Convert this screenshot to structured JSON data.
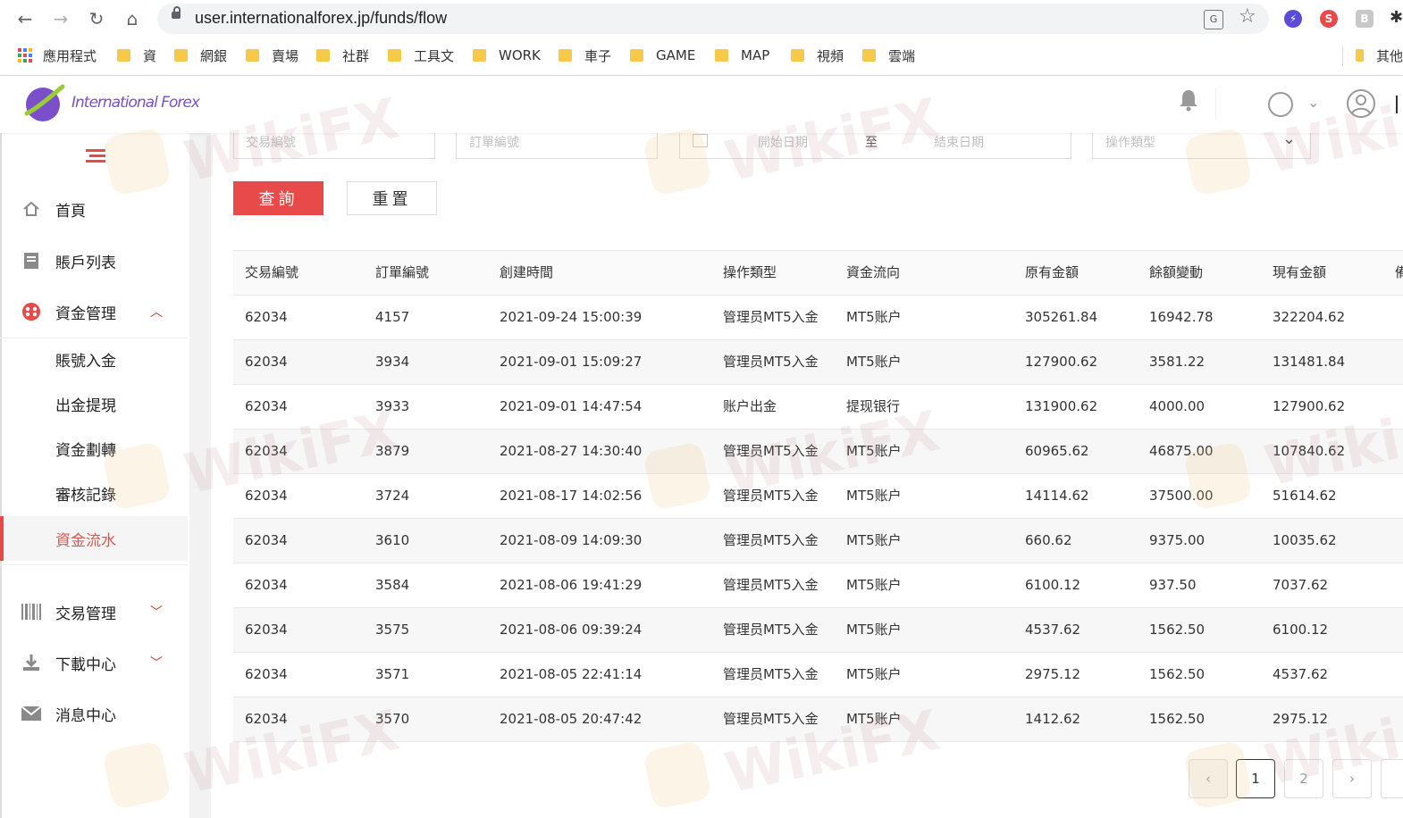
{
  "browser": {
    "url": "user.internationalforex.jp/funds/flow",
    "extensions": [
      "S",
      "B"
    ],
    "bookmarks": [
      "應用程式",
      "資",
      "網銀",
      "賣場",
      "社群",
      "工具文",
      "WORK",
      "車子",
      "GAME",
      "MAP",
      "視頻",
      "雲端",
      "其他"
    ]
  },
  "header": {
    "logo_text": "International Forex"
  },
  "sidebar": {
    "items": [
      {
        "label": "首頁",
        "icon": "home-icon"
      },
      {
        "label": "賬戶列表",
        "icon": "list-icon"
      },
      {
        "label": "資金管理",
        "icon": "funds-icon"
      },
      {
        "label": "交易管理",
        "icon": "barcode-icon"
      },
      {
        "label": "下載中心",
        "icon": "download-icon"
      },
      {
        "label": "消息中心",
        "icon": "mail-icon"
      }
    ],
    "sub_items": [
      "賬號入金",
      "出金提現",
      "資金劃轉",
      "審核記錄",
      "資金流水"
    ]
  },
  "filters": {
    "trade_no_placeholder": "交易編號",
    "order_no_placeholder": "訂單編號",
    "start_date_placeholder": "開始日期",
    "date_sep": "至",
    "end_date_placeholder": "結束日期",
    "op_type_placeholder": "操作類型",
    "query_label": "查詢",
    "reset_label": "重置"
  },
  "table": {
    "headers": [
      "交易編號",
      "訂單編號",
      "創建時間",
      "操作類型",
      "資金流向",
      "原有金額",
      "餘額變動",
      "現有金額",
      "備"
    ],
    "rows": [
      [
        "62034",
        "4157",
        "2021-09-24 15:00:39",
        "管理员MT5入金",
        "MT5账户",
        "305261.84",
        "16942.78",
        "322204.62"
      ],
      [
        "62034",
        "3934",
        "2021-09-01 15:09:27",
        "管理员MT5入金",
        "MT5账户",
        "127900.62",
        "3581.22",
        "131481.84"
      ],
      [
        "62034",
        "3933",
        "2021-09-01 14:47:54",
        "账户出金",
        "提现银行",
        "131900.62",
        "4000.00",
        "127900.62"
      ],
      [
        "62034",
        "3879",
        "2021-08-27 14:30:40",
        "管理员MT5入金",
        "MT5账户",
        "60965.62",
        "46875.00",
        "107840.62"
      ],
      [
        "62034",
        "3724",
        "2021-08-17 14:02:56",
        "管理员MT5入金",
        "MT5账户",
        "14114.62",
        "37500.00",
        "51614.62"
      ],
      [
        "62034",
        "3610",
        "2021-08-09 14:09:30",
        "管理员MT5入金",
        "MT5账户",
        "660.62",
        "9375.00",
        "10035.62"
      ],
      [
        "62034",
        "3584",
        "2021-08-06 19:41:29",
        "管理员MT5入金",
        "MT5账户",
        "6100.12",
        "937.50",
        "7037.62"
      ],
      [
        "62034",
        "3575",
        "2021-08-06 09:39:24",
        "管理员MT5入金",
        "MT5账户",
        "4537.62",
        "1562.50",
        "6100.12"
      ],
      [
        "62034",
        "3571",
        "2021-08-05 22:41:14",
        "管理员MT5入金",
        "MT5账户",
        "2975.12",
        "1562.50",
        "4537.62"
      ],
      [
        "62034",
        "3570",
        "2021-08-05 20:47:42",
        "管理员MT5入金",
        "MT5账户",
        "1412.62",
        "1562.50",
        "2975.12"
      ]
    ]
  },
  "pagination": {
    "prev": "‹",
    "pages": [
      "1",
      "2"
    ],
    "next": "›"
  },
  "watermark": "WikiFX",
  "colors": {
    "accent_red": "#e84a4a",
    "active_text": "#e0554e"
  }
}
